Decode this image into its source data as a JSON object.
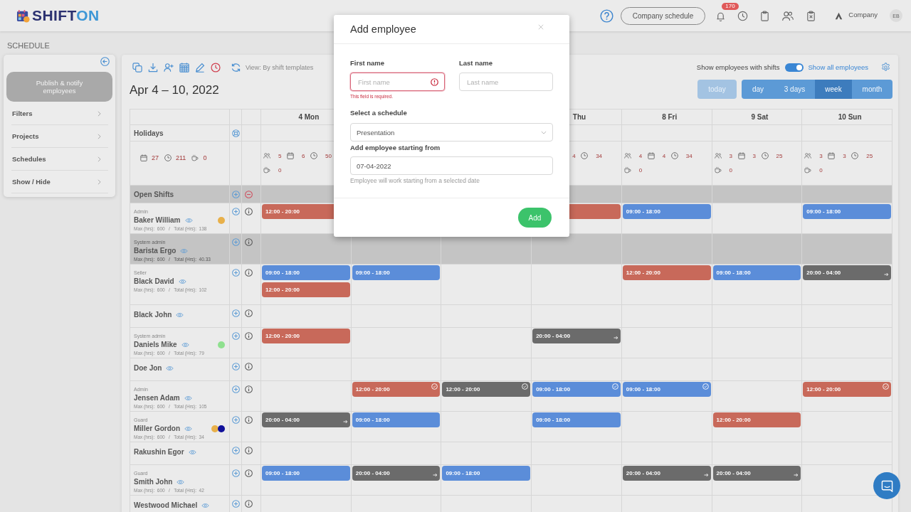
{
  "header": {
    "logo": [
      "SHIFT",
      "ON"
    ],
    "schedule_button": "Company schedule",
    "notifications": "170",
    "company": "Company",
    "avatar": "EB"
  },
  "page_title": "SCHEDULE",
  "sidebar": {
    "publish_button": "Publish & notify employees",
    "items": [
      "Filters",
      "Projects",
      "Schedules",
      "Show / Hide"
    ]
  },
  "toolbar": {
    "view_label": "View: By shift templates",
    "show_with_shifts": {
      "label": "Show employees with shifts",
      "on": true
    },
    "show_all_link": "Show all employees",
    "date_range": "Apr 4 – 10, 2022",
    "today_button": {
      "label": "today",
      "disabled": true
    },
    "view_tabs": [
      {
        "label": "day",
        "selected": false
      },
      {
        "label": "3 days",
        "selected": false
      },
      {
        "label": "week",
        "selected": true
      },
      {
        "label": "month",
        "selected": false
      }
    ]
  },
  "grid": {
    "holidays_label": "Holidays",
    "totals": [
      {
        "kind": "days",
        "value": "27"
      },
      {
        "kind": "hours",
        "value": "211"
      },
      {
        "kind": "breaks",
        "value": "0"
      }
    ],
    "open_shifts_label": "Open Shifts",
    "days": {
      "column_1": {
        "label": "4 Mon",
        "stats": [
          {
            "kind": "staff",
            "value": "5"
          },
          {
            "kind": "days",
            "value": "6"
          },
          {
            "kind": "hours",
            "value": "50"
          },
          {
            "kind": "breaks",
            "value": "0"
          }
        ]
      },
      "column_4": {
        "label": "Thu",
        "stats": [
          {
            "kind": "days_figure",
            "value": "4"
          },
          {
            "kind": "hours",
            "value": "34"
          }
        ]
      },
      "column_5": {
        "label": "8 Fri",
        "stats": [
          {
            "kind": "staff",
            "value": "4"
          },
          {
            "kind": "days",
            "value": "4"
          },
          {
            "kind": "hours",
            "value": "34"
          },
          {
            "kind": "breaks",
            "value": "0"
          }
        ]
      },
      "column_6": {
        "label": "9 Sat",
        "stats": [
          {
            "kind": "staff",
            "value": "3"
          },
          {
            "kind": "days",
            "value": "3"
          },
          {
            "kind": "hours",
            "value": "25"
          },
          {
            "kind": "breaks",
            "value": "0"
          }
        ]
      },
      "column_7": {
        "label": "10 Sun",
        "stats": [
          {
            "kind": "staff",
            "value": "3"
          },
          {
            "kind": "days",
            "value": "3"
          },
          {
            "kind": "hours",
            "value": "25"
          },
          {
            "kind": "breaks",
            "value": "0"
          }
        ]
      }
    },
    "employees": [
      {
        "role": "Admin",
        "name": "Baker William",
        "dots": [
          {
            "color": "#e8b04a"
          }
        ],
        "hours": "Max (hrs):  600   /   Total (Hrs):  138",
        "highlighted": false,
        "shifts": {
          "column_1": [
            {
              "kind": "plain",
              "time": "12:00 - 20:00",
              "color": "#c8695a"
            }
          ],
          "column_4": [
            {
              "kind": "plain",
              "color": "#c8695a"
            }
          ],
          "column_5": [
            {
              "kind": "plain",
              "time": "09:00 - 18:00",
              "color": "#5b8dd9"
            }
          ],
          "column_7": [
            {
              "kind": "plain",
              "time": "09:00 - 18:00",
              "color": "#5b8dd9"
            }
          ]
        }
      },
      {
        "role": "System admin",
        "name": "Barista Ergo",
        "hours": "Max (hrs):  600   /   Total (Hrs):  40.33",
        "highlighted": true
      },
      {
        "role": "Seller",
        "name": "Black David",
        "hours": "Max (hrs):  600   /   Total (Hrs):  102",
        "highlighted": false,
        "shifts": {
          "column_1": [
            {
              "kind": "plain",
              "time": "09:00 - 18:00",
              "color": "#5b8dd9"
            },
            {
              "kind": "plain",
              "time": "12:00 - 20:00",
              "color": "#c8695a"
            }
          ],
          "column_2": [
            {
              "kind": "plain",
              "time": "09:00 - 18:00",
              "color": "#5b8dd9"
            }
          ],
          "column_5": [
            {
              "kind": "plain",
              "time": "12:00 - 20:00",
              "color": "#c8695a"
            }
          ],
          "column_6": [
            {
              "kind": "plain",
              "time": "09:00 - 18:00",
              "color": "#5b8dd9"
            }
          ],
          "column_7": [
            {
              "kind": "overnight",
              "time": "20:00 - 04:00",
              "color": "#6b6b6b"
            }
          ]
        }
      },
      {
        "name": "Black John",
        "highlighted": false
      },
      {
        "role": "System admin",
        "name": "Daniels Mike",
        "dots": [
          {
            "color": "#8fe08f"
          }
        ],
        "hours": "Max (hrs):  600   /   Total (Hrs):  79",
        "highlighted": false,
        "shifts": {
          "column_1": [
            {
              "kind": "plain",
              "time": "12:00 - 20:00",
              "color": "#c8695a"
            }
          ],
          "column_4": [
            {
              "kind": "overnight",
              "time": "20:00 - 04:00",
              "color": "#6b6b6b"
            }
          ]
        }
      },
      {
        "name": "Doe Jon",
        "highlighted": false
      },
      {
        "role": "Admin",
        "name": "Jensen Adam",
        "hours": "Max (hrs):  600   /   Total (Hrs):  105",
        "highlighted": false,
        "shifts": {
          "column_2": [
            {
              "kind": "confirmed",
              "time": "12:00 - 20:00",
              "color": "#c8695a"
            }
          ],
          "column_3": [
            {
              "kind": "confirmed",
              "time": "12:00 - 20:00",
              "color": "#6b6b6b"
            }
          ],
          "column_4": [
            {
              "kind": "confirmed",
              "time": "09:00 - 18:00",
              "color": "#5b8dd9"
            }
          ],
          "column_5": [
            {
              "kind": "confirmed",
              "time": "09:00 - 18:00",
              "color": "#5b8dd9"
            }
          ],
          "column_7": [
            {
              "kind": "confirmed",
              "time": "12:00 - 20:00",
              "color": "#c8695a"
            }
          ]
        }
      },
      {
        "role": "Guard",
        "name": "Miller Gordon",
        "dots": [
          {
            "color": "#e8b04a"
          },
          {
            "color": "#10109a"
          }
        ],
        "hours": "Max (hrs):  600   /   Total (Hrs):  34",
        "highlighted": false,
        "shifts": {
          "column_1": [
            {
              "kind": "overnight",
              "time": "20:00 - 04:00",
              "color": "#6b6b6b"
            }
          ],
          "column_2": [
            {
              "kind": "plain",
              "time": "09:00 - 18:00",
              "color": "#5b8dd9"
            }
          ],
          "column_4": [
            {
              "kind": "plain",
              "time": "09:00 - 18:00",
              "color": "#5b8dd9"
            }
          ],
          "column_6": [
            {
              "kind": "plain",
              "time": "12:00 - 20:00",
              "color": "#c8695a"
            }
          ]
        }
      },
      {
        "name": "Rakushin Egor",
        "highlighted": false
      },
      {
        "role": "Guard",
        "name": "Smith John",
        "hours": "Max (hrs):  600   /   Total (Hrs):  42",
        "highlighted": false,
        "shifts": {
          "column_1": [
            {
              "kind": "plain",
              "time": "09:00 - 18:00",
              "color": "#5b8dd9"
            }
          ],
          "column_2": [
            {
              "kind": "overnight",
              "time": "20:00 - 04:00",
              "color": "#6b6b6b"
            }
          ],
          "column_3": [
            {
              "kind": "plain",
              "time": "09:00 - 18:00",
              "color": "#5b8dd9"
            }
          ],
          "column_5": [
            {
              "kind": "overnight",
              "time": "20:00 - 04:00",
              "color": "#6b6b6b"
            }
          ],
          "column_6": [
            {
              "kind": "overnight",
              "time": "20:00 - 04:00",
              "color": "#6b6b6b"
            }
          ]
        }
      },
      {
        "name": "Westwood Michael",
        "highlighted": false
      }
    ]
  },
  "modal": {
    "title": "Add employee",
    "first_name": {
      "label": "First name",
      "placeholder": "First name",
      "error": "This field is required."
    },
    "last_name": {
      "label": "Last name",
      "placeholder": "Last name"
    },
    "schedule": {
      "label": "Select a schedule",
      "value": "Presentation"
    },
    "start_date": {
      "label": "Add employee starting from",
      "value": "07-04-2022",
      "hint": "Employee will work starting from a selected date"
    },
    "submit": "Add"
  }
}
